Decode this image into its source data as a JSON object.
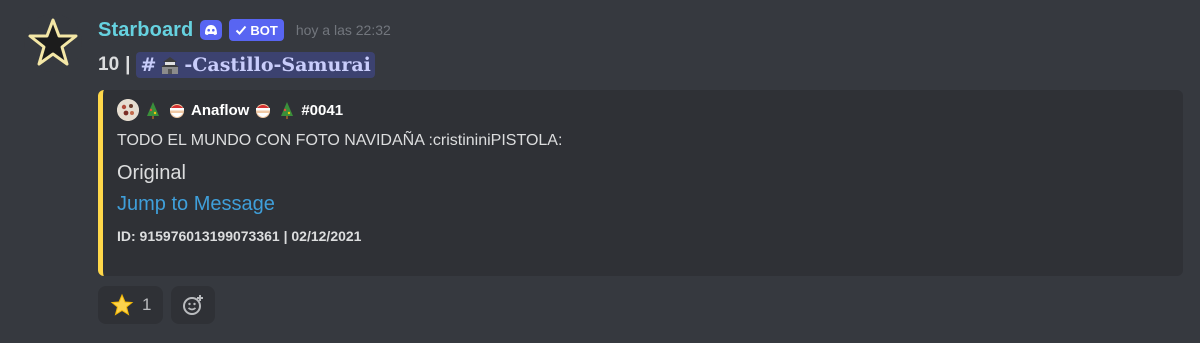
{
  "author": {
    "username": "Starboard",
    "bot_tag": "BOT",
    "timestamp": "hoy a las 22:32"
  },
  "message": {
    "count": "10",
    "separator": "|",
    "channel_hash": "#",
    "channel_name": "-Castillo-Samurai"
  },
  "embed": {
    "accent_color": "#ffd84a",
    "author_name": "Anaflow",
    "author_tag": "#0041",
    "description": "TODO EL MUNDO CON FOTO NAVIDAÑA :cristininiPISTOLA:",
    "field_value": "Original",
    "link_text": "Jump to Message",
    "footer": "ID: 915976013199073361 | 02/12/2021"
  },
  "reactions": [
    {
      "emoji": "star-emoji",
      "count": "1"
    }
  ],
  "colors": {
    "background": "#36393f",
    "username": "#66d2e0",
    "bot_tag": "#5865f2",
    "link": "#3f9fda"
  }
}
